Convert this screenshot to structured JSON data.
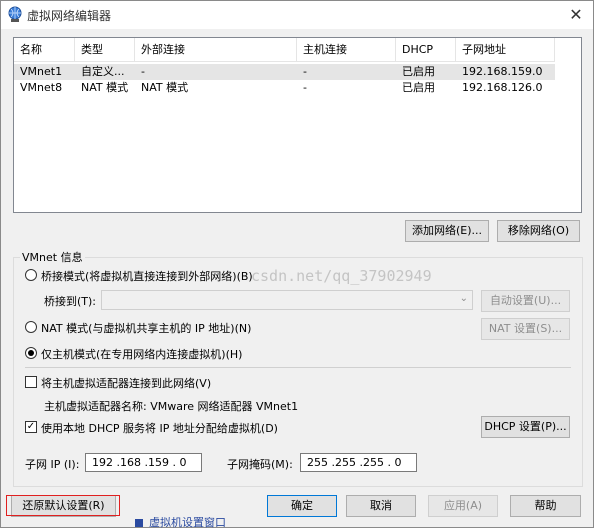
{
  "window": {
    "title": "虚拟网络编辑器",
    "close_glyph": "✕"
  },
  "table": {
    "columns": [
      "名称",
      "类型",
      "外部连接",
      "主机连接",
      "DHCP",
      "子网地址"
    ],
    "rows": [
      [
        "VMnet1",
        "自定义...",
        "-",
        "-",
        "已启用",
        "192.168.159.0"
      ],
      [
        "VMnet8",
        "NAT 模式",
        "NAT 模式",
        "-",
        "已启用",
        "192.168.126.0"
      ]
    ],
    "selected_row": 0
  },
  "buttons": {
    "add_network": "添加网络(E)...",
    "remove_network": "移除网络(O)",
    "auto_settings": "自动设置(U)...",
    "nat_settings": "NAT 设置(S)...",
    "dhcp_settings": "DHCP 设置(P)...",
    "restore_defaults": "还原默认设置(R)",
    "ok": "确定",
    "cancel": "取消",
    "apply": "应用(A)",
    "help": "帮助"
  },
  "vmnet_info": {
    "group_label": "VMnet 信息",
    "bridged_label": "桥接模式(将虚拟机直接连接到外部网络)(B)",
    "bridged_to_label": "桥接到(T):",
    "bridged_to_value": "",
    "nat_label": "NAT 模式(与虚拟机共享主机的 IP 地址)(N)",
    "hostonly_label": "仅主机模式(在专用网络内连接虚拟机)(H)",
    "selected_mode": "hostonly",
    "connect_adapter_label": "将主机虚拟适配器连接到此网络(V)",
    "connect_adapter_checked": false,
    "adapter_name_label": "主机虚拟适配器名称: VMware 网络适配器 VMnet1",
    "use_dhcp_label": "使用本地 DHCP 服务将 IP 地址分配给虚拟机(D)",
    "use_dhcp_checked": true,
    "check_glyph": "✓",
    "subnet_ip_label": "子网 IP (I):",
    "subnet_ip_value": "192 .168 .159 . 0",
    "subnet_mask_label": "子网掩码(M):",
    "subnet_mask_value": "255 .255 .255 . 0"
  },
  "watermark": "csdn.net/qq_37902949",
  "background_snippet": "虚拟机设置窗口",
  "colors": {
    "highlight": "#e02020",
    "selected_row": "#e5e5e5",
    "default_border": "#0078d7"
  }
}
